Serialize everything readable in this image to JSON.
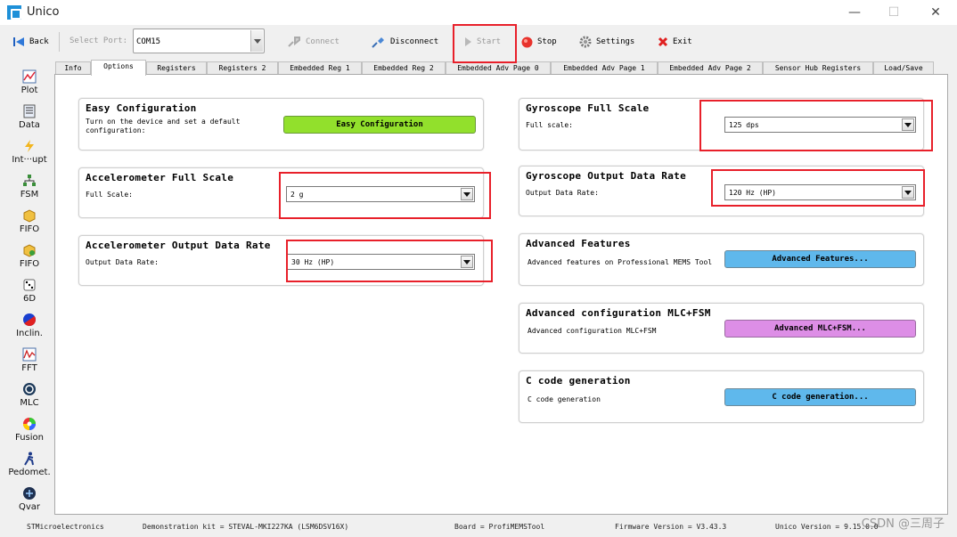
{
  "window": {
    "title": "Unico",
    "minimize": "—",
    "maximize": "☐",
    "close": "✕"
  },
  "toolbar": {
    "back": "Back",
    "select_port_label": "Select Port:",
    "port_value": "COM15",
    "connect": "Connect",
    "disconnect": "Disconnect",
    "start": "Start",
    "stop": "Stop",
    "settings": "Settings",
    "exit": "Exit"
  },
  "sidebar": {
    "items": [
      {
        "label": "Plot",
        "icon": "plot-icon"
      },
      {
        "label": "Data",
        "icon": "data-icon"
      },
      {
        "label": "Int···upt",
        "icon": "interrupt-icon"
      },
      {
        "label": "FSM",
        "icon": "fsm-icon"
      },
      {
        "label": "FIFO",
        "icon": "fifo-icon"
      },
      {
        "label": "FIFO",
        "icon": "fifo-compress-icon"
      },
      {
        "label": "6D",
        "icon": "dice-icon"
      },
      {
        "label": "Inclin.",
        "icon": "inclination-icon"
      },
      {
        "label": "FFT",
        "icon": "fft-icon"
      },
      {
        "label": "MLC",
        "icon": "mlc-icon"
      },
      {
        "label": "Fusion",
        "icon": "fusion-icon"
      },
      {
        "label": "Pedomet.",
        "icon": "pedometer-icon"
      },
      {
        "label": "Qvar",
        "icon": "qvar-icon"
      }
    ]
  },
  "tabs": [
    {
      "label": "Info"
    },
    {
      "label": "Options"
    },
    {
      "label": "Registers"
    },
    {
      "label": "Registers 2"
    },
    {
      "label": "Embedded Reg 1"
    },
    {
      "label": "Embedded Reg 2"
    },
    {
      "label": "Embedded Adv Page 0"
    },
    {
      "label": "Embedded Adv Page 1"
    },
    {
      "label": "Embedded Adv Page 2"
    },
    {
      "label": "Sensor Hub Registers"
    },
    {
      "label": "Load/Save"
    }
  ],
  "easy_config": {
    "title": "Easy Configuration",
    "description": "Turn on the device and set a default configuration:",
    "button": "Easy Configuration"
  },
  "accel_fs": {
    "title": "Accelerometer Full Scale",
    "label": "Full Scale:",
    "value": "2 g"
  },
  "accel_odr": {
    "title": "Accelerometer Output Data Rate",
    "label": "Output Data Rate:",
    "value": "30 Hz (HP)"
  },
  "gyro_fs": {
    "title": "Gyroscope Full Scale",
    "label": "Full scale:",
    "value": "125 dps"
  },
  "gyro_odr": {
    "title": "Gyroscope Output Data Rate",
    "label": "Output Data Rate:",
    "value": "120 Hz (HP)"
  },
  "advanced": {
    "title": "Advanced Features",
    "label": "Advanced features on Professional MEMS Tool",
    "button": "Advanced Features..."
  },
  "mlc_fsm": {
    "title": "Advanced configuration MLC+FSM",
    "label": "Advanced configuration MLC+FSM",
    "button": "Advanced MLC+FSM..."
  },
  "c_code": {
    "title": "C code generation",
    "label": "C code generation",
    "button": "C code generation..."
  },
  "status": {
    "company": "STMicroelectronics",
    "kit": "Demonstration kit = STEVAL-MKI227KA (LSM6DSV16X)",
    "board": "Board = ProfiMEMSTool",
    "firmware": "Firmware Version = V3.43.3",
    "unico": "Unico Version = 9.15.0.0"
  },
  "watermark": "CSDN @三周子",
  "colors": {
    "easy_button": "#92e02c",
    "blue_button": "#5fb8ec",
    "mlc_button": "#dd8ee6",
    "highlight_box": "#e8202a"
  }
}
